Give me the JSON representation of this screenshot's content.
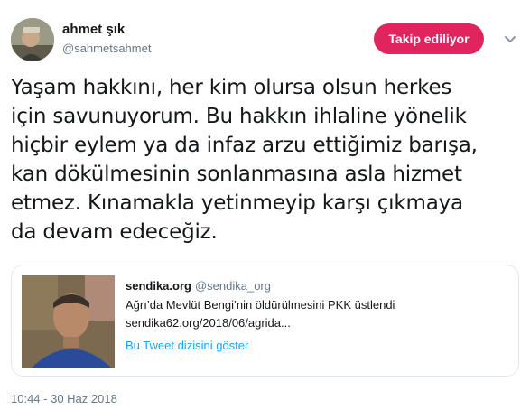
{
  "author": {
    "name": "ahmet şık",
    "handle": "@sahmetsahmet"
  },
  "follow_button": {
    "label": "Takip ediliyor",
    "color": "#e0245e"
  },
  "tweet": {
    "lines": [
      "Yaşam hakkını, her kim olursa olsun herkes",
      "için savunuyorum. Bu hakkın ihlaline yönelik",
      "hiçbir eylem ya da infaz arzu ettiğimiz barışa,",
      "kan dökülmesinin sonlanmasına asla hizmet",
      "etmez. Kınamakla yetinmeyip karşı çıkmaya",
      "da devam edeceğiz."
    ],
    "timestamp": "10:44 - 30 Haz 2018"
  },
  "quoted_tweet": {
    "name": "sendika.org",
    "handle": "@sendika_org",
    "text": "Ağrı’da Mevlüt Bengi’nin öldürülmesini PKK üstlendi",
    "link": "sendika62.org/2018/06/agrida...",
    "thread_link": "Bu Tweet dizisini göster"
  },
  "icons": {
    "caret": "chevron-down-icon",
    "link_color": "#1da1f2"
  }
}
